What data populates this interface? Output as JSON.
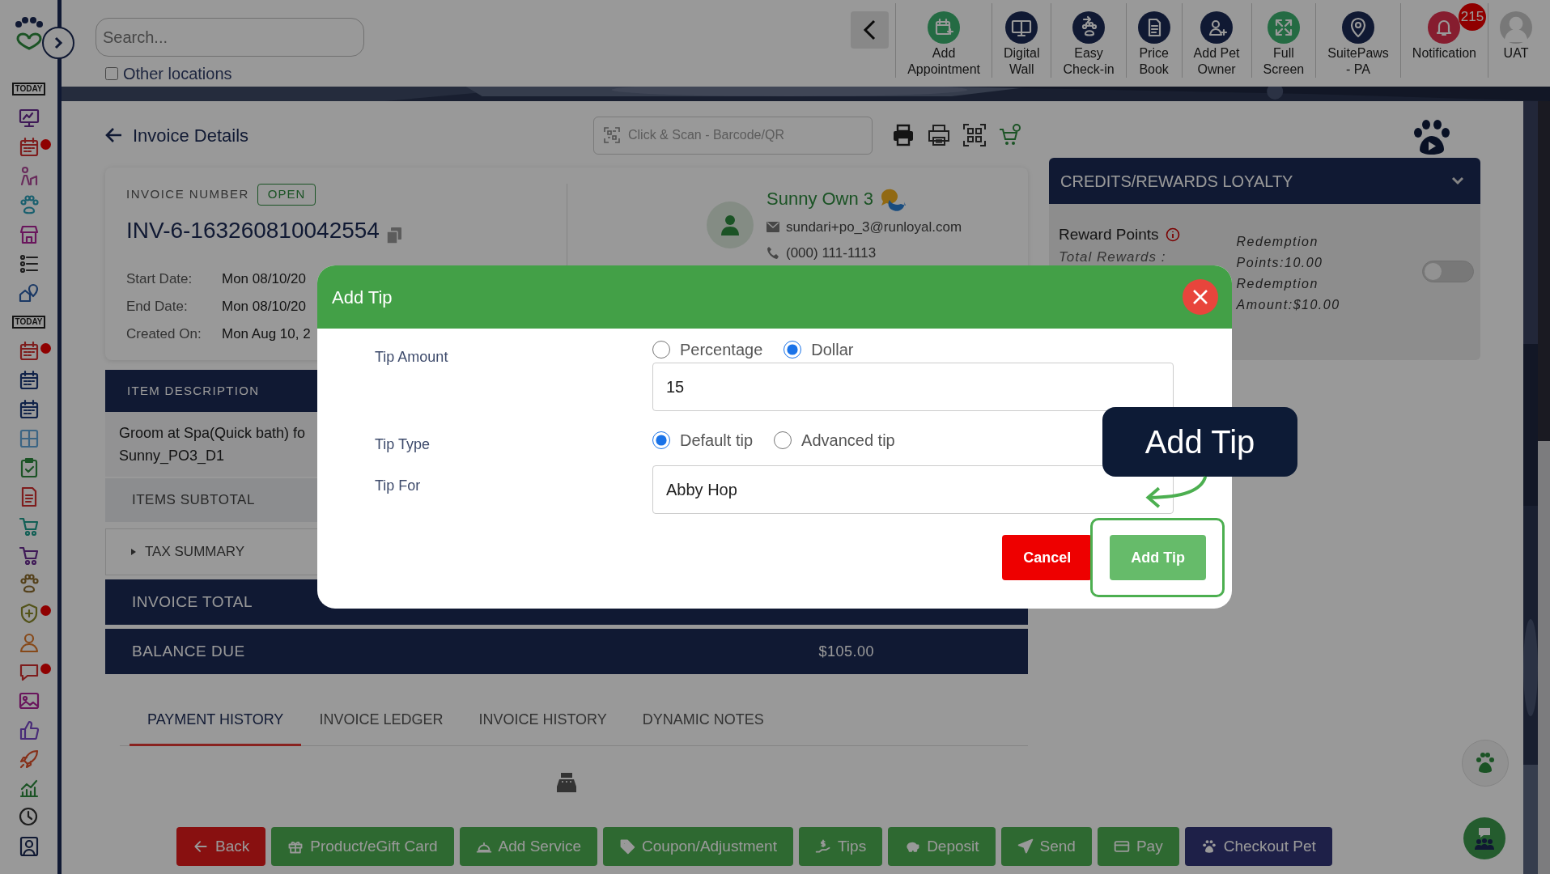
{
  "sidebar": {
    "items": [
      {
        "label": "TODAY",
        "alert": false
      },
      {
        "alert": false
      },
      {
        "alert": true
      },
      {
        "alert": false
      },
      {
        "alert": false
      },
      {
        "alert": false
      },
      {
        "alert": false
      },
      {
        "alert": false
      },
      {
        "label": "TODAY",
        "alert": false
      },
      {
        "alert": true
      },
      {
        "alert": false
      },
      {
        "alert": false
      },
      {
        "alert": false
      },
      {
        "alert": false
      },
      {
        "alert": false
      },
      {
        "alert": false
      },
      {
        "alert": false
      },
      {
        "alert": false
      },
      {
        "alert": true
      },
      {
        "alert": false
      },
      {
        "alert": true
      },
      {
        "alert": false
      },
      {
        "alert": false
      },
      {
        "alert": false
      },
      {
        "alert": false
      },
      {
        "alert": false
      },
      {
        "alert": false
      }
    ]
  },
  "header": {
    "search": {
      "placeholder": "Search..."
    },
    "other_locations": {
      "label": "Other locations",
      "checked": false
    },
    "toolbar": [
      {
        "lines": [
          "Add",
          "Appointment"
        ]
      },
      {
        "lines": [
          "Digital",
          "Wall"
        ]
      },
      {
        "lines": [
          "Easy",
          "Check-in"
        ]
      },
      {
        "lines": [
          "Price",
          "Book"
        ]
      },
      {
        "lines": [
          "Add Pet",
          "Owner"
        ]
      },
      {
        "lines": [
          "Full",
          "Screen"
        ]
      },
      {
        "lines": [
          "SuitePaws",
          "- PA"
        ]
      },
      {
        "lines": [
          "Notification"
        ],
        "badge": "215"
      },
      {
        "lines": [
          "UAT"
        ]
      }
    ]
  },
  "invoice": {
    "title": "Invoice Details",
    "scan": {
      "placeholder": "Click & Scan - Barcode/QR"
    },
    "number_label": "INVOICE NUMBER",
    "status": "OPEN",
    "number": "INV-6-163260810042554",
    "dates": [
      {
        "label": "Start Date:",
        "value": "Mon 08/10/20"
      },
      {
        "label": "End Date:",
        "value": "Mon 08/10/20"
      },
      {
        "label": "Created On:",
        "value": "Mon Aug 10, 2"
      }
    ],
    "customer": {
      "name": "Sunny Own 3",
      "email": "sundari+po_3@runloyal.com",
      "phone": "(000) 111-1113"
    }
  },
  "credits": {
    "title": "CREDITS/REWARDS LOYALTY",
    "reward_points_label": "Reward Points",
    "total_rewards_label": "Total Rewards :",
    "redemption_points": "Redemption Points:10.00",
    "redemption_amount": "Redemption Amount:$10.00",
    "on": false
  },
  "items_table": {
    "header": "ITEM DESCRIPTION",
    "item_lines": [
      "Groom at Spa(Quick bath) fo",
      "Sunny_PO3_D1"
    ],
    "subtotal_label": "ITEMS SUBTOTAL",
    "tax_label": "TAX SUMMARY",
    "tax_expanded": false,
    "total_label": "INVOICE TOTAL",
    "balance_label": "BALANCE DUE",
    "balance": "$105.00"
  },
  "tabs": [
    {
      "label": "PAYMENT HISTORY",
      "selected": true
    },
    {
      "label": "INVOICE LEDGER",
      "selected": false
    },
    {
      "label": "INVOICE HISTORY",
      "selected": false
    },
    {
      "label": "DYNAMIC NOTES",
      "selected": false
    }
  ],
  "actions": [
    {
      "label": "Back",
      "kind": "danger"
    },
    {
      "label": "Product/eGift Card",
      "kind": "success"
    },
    {
      "label": "Add Service",
      "kind": "success"
    },
    {
      "label": "Coupon/Adjustment",
      "kind": "success"
    },
    {
      "label": "Tips",
      "kind": "success"
    },
    {
      "label": "Deposit",
      "kind": "success"
    },
    {
      "label": "Send",
      "kind": "success"
    },
    {
      "label": "Pay",
      "kind": "success"
    },
    {
      "label": "Checkout Pet",
      "kind": "dark"
    }
  ],
  "modal": {
    "title": "Add Tip",
    "tip_amount": {
      "label": "Tip Amount",
      "options": [
        {
          "label": "Percentage",
          "selected": false
        },
        {
          "label": "Dollar",
          "selected": true
        }
      ],
      "value": "15"
    },
    "tip_type": {
      "label": "Tip Type",
      "options": [
        {
          "label": "Default tip",
          "selected": true
        },
        {
          "label": "Advanced tip",
          "selected": false
        }
      ]
    },
    "tip_for": {
      "label": "Tip For",
      "value": "Abby Hop"
    },
    "buttons": [
      {
        "label": "Cancel",
        "kind": "danger"
      },
      {
        "label": "Add Tip",
        "kind": "success"
      }
    ]
  },
  "callout": {
    "text": "Add Tip"
  }
}
